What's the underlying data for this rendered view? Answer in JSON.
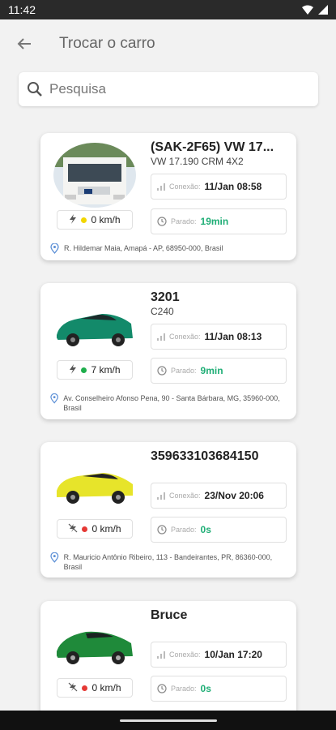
{
  "status_bar": {
    "time": "11:42"
  },
  "header": {
    "title": "Trocar o carro"
  },
  "search": {
    "placeholder": "Pesquisa"
  },
  "labels": {
    "connection": "Conexão:",
    "stopped": "Parado:"
  },
  "cards": [
    {
      "name": "(SAK-2F65) VW 17...",
      "model": "VW 17.190 CRM 4X2",
      "speed": "0 km/h",
      "ignition": "on",
      "status_color": "#f2d600",
      "connection": "11/Jan 08:58",
      "stopped": "19min",
      "address": "R. Hildemar Maia, Amapá - AP, 68950-000, Brasil",
      "image": "truck"
    },
    {
      "name": "3201",
      "model": "C240",
      "speed": "7 km/h",
      "ignition": "on",
      "status_color": "#1fae4c",
      "connection": "11/Jan 08:13",
      "stopped": "9min",
      "address": "Av. Conselheiro Afonso Pena, 90 - Santa Bárbara, MG, 35960-000, Brasil",
      "image": "green-sedan"
    },
    {
      "name": "359633103684150",
      "model": "",
      "speed": "0 km/h",
      "ignition": "off",
      "status_color": "#e53935",
      "connection": "23/Nov 20:06",
      "stopped": "0s",
      "address": "R. Mauricio Antônio Ribeiro, 113 - Bandeirantes, PR, 86360-000, Brasil",
      "image": "yellow-car"
    },
    {
      "name": "Bruce",
      "model": "",
      "speed": "0 km/h",
      "ignition": "off",
      "status_color": "#e53935",
      "connection": "10/Jan 17:20",
      "stopped": "0s",
      "address": "",
      "image": "green-porsche"
    }
  ],
  "colors": {
    "accent": "#1fae76",
    "background": "#f2f2f2"
  }
}
